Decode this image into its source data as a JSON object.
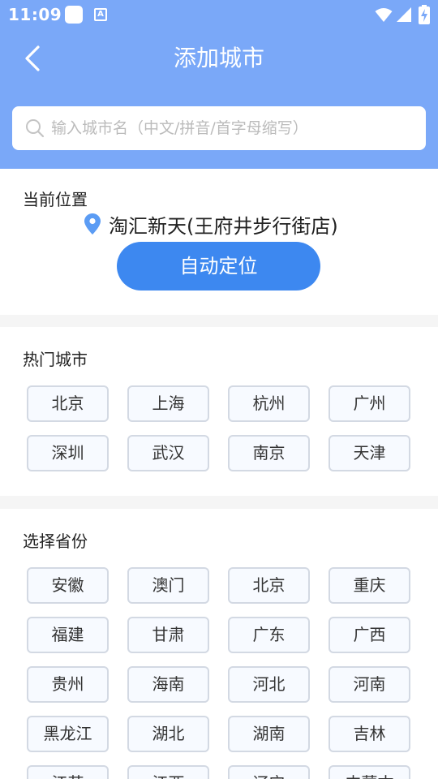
{
  "status_bar": {
    "time": "11:09",
    "a_label": "A",
    "icons": [
      "notification-square-icon",
      "a-box-icon",
      "wifi-icon",
      "signal-icon",
      "battery-charging-icon"
    ]
  },
  "header": {
    "title": "添加城市",
    "back_icon": "chevron-left-icon",
    "bg_color": "#7aa8f8"
  },
  "search": {
    "placeholder": "输入城市名（中文/拼音/首字母缩写）",
    "icon": "search-icon"
  },
  "current_location": {
    "heading": "当前位置",
    "location": "淘汇新天(王府井步行街店)",
    "auto_button": "自动定位",
    "pin_color": "#5b9cf4",
    "button_color": "#3d88f0"
  },
  "hot_cities": {
    "heading": "热门城市",
    "items": [
      "北京",
      "上海",
      "杭州",
      "广州",
      "深圳",
      "武汉",
      "南京",
      "天津"
    ]
  },
  "provinces": {
    "heading": "选择省份",
    "items": [
      "安徽",
      "澳门",
      "北京",
      "重庆",
      "福建",
      "甘肃",
      "广东",
      "广西",
      "贵州",
      "海南",
      "河北",
      "河南",
      "黑龙江",
      "湖北",
      "湖南",
      "吉林",
      "江苏",
      "江西",
      "辽宁",
      "内蒙古"
    ]
  }
}
